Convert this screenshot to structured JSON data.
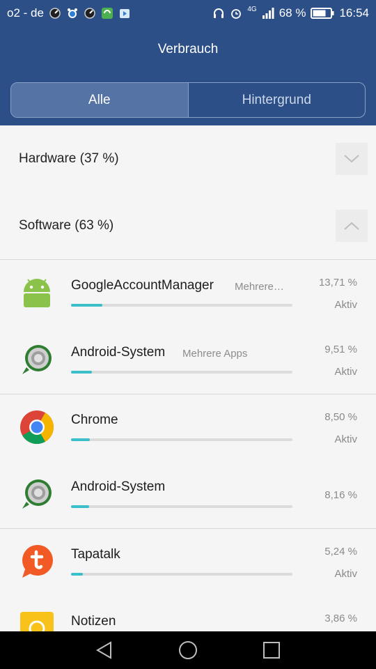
{
  "status_bar": {
    "carrier": "o2 - de",
    "network": "4G",
    "battery": "68 %",
    "time": "16:54"
  },
  "header": {
    "title": "Verbrauch",
    "tabs": [
      {
        "label": "Alle",
        "active": true
      },
      {
        "label": "Hintergrund",
        "active": false
      }
    ]
  },
  "sections": [
    {
      "label": "Hardware (37 %)",
      "chevron": "chevron-down-icon"
    },
    {
      "label": "Software (63 %)",
      "chevron": "chevron-up-icon"
    }
  ],
  "apps": [
    {
      "name": "GoogleAccountManager",
      "sub": "Mehrere…",
      "percent": "13,71 %",
      "status": "Aktiv",
      "fill": 0.14,
      "icon": "android-icon"
    },
    {
      "name": "Android-System",
      "sub": "Mehrere Apps",
      "percent": "9,51 %",
      "status": "Aktiv",
      "fill": 0.095,
      "icon": "android-system-icon"
    },
    {
      "name": "Chrome",
      "sub": "",
      "percent": "8,50 %",
      "status": "Aktiv",
      "fill": 0.085,
      "icon": "chrome-icon"
    },
    {
      "name": "Android-System",
      "sub": "",
      "percent": "8,16 %",
      "status": "",
      "fill": 0.082,
      "icon": "android-system-icon"
    },
    {
      "name": "Tapatalk",
      "sub": "",
      "percent": "5,24 %",
      "status": "Aktiv",
      "fill": 0.052,
      "icon": "tapatalk-icon"
    },
    {
      "name": "Notizen",
      "sub": "",
      "percent": "3,86 %",
      "status": "",
      "fill": 0.039,
      "icon": "notes-icon"
    }
  ],
  "colors": {
    "header_bg": "#2b4f86",
    "bar_fill": "#3bbfcb"
  }
}
